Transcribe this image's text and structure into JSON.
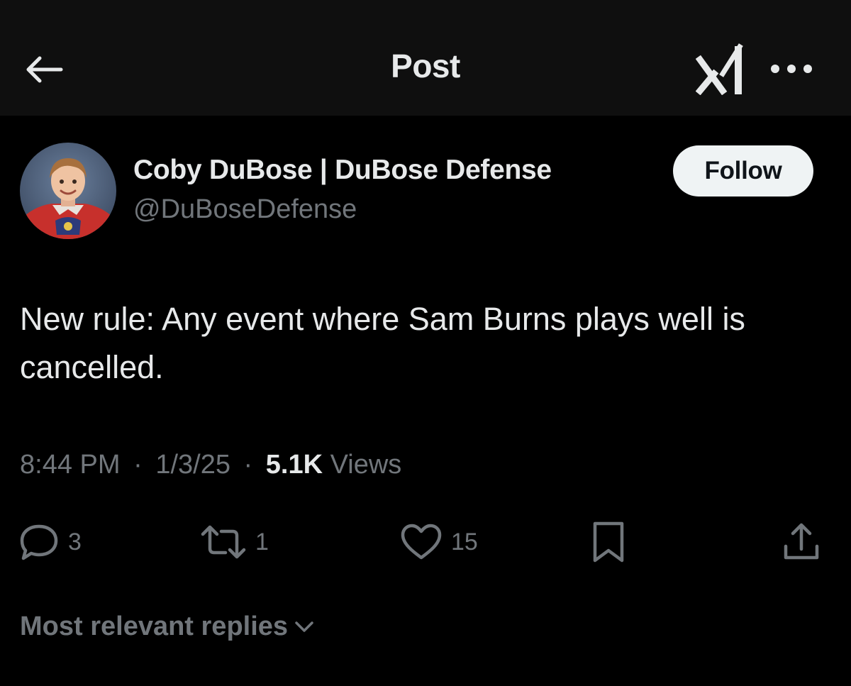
{
  "header": {
    "title": "Post",
    "back_icon": "arrow-left-icon",
    "grok_icon": "grok-icon",
    "more_icon": "more-dots-icon"
  },
  "author": {
    "display_name": "Coby DuBose | DuBose Defense",
    "handle": "@DuBoseDefense",
    "follow_label": "Follow"
  },
  "post": {
    "text": "New rule: Any event where Sam Burns plays well is cancelled.",
    "time": "8:44 PM",
    "date": "1/3/25",
    "separator": "·",
    "views_count": "5.1K",
    "views_label": "Views"
  },
  "actions": {
    "replies": "3",
    "reposts": "1",
    "likes": "15"
  },
  "replies_sort": {
    "label": "Most relevant replies"
  },
  "colors": {
    "background": "#000000",
    "header_bg": "#0f0f0f",
    "primary_text": "#e7e9ea",
    "secondary_text": "#71767b",
    "follow_bg": "#eff3f4",
    "follow_text": "#0f1419"
  }
}
